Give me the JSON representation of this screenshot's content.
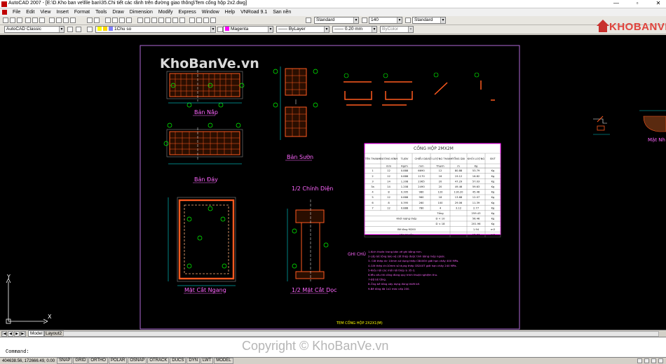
{
  "window": {
    "title": "AutoCAD 2007 - [E:\\D.Kho ban ve\\file ban\\35.Chi tiết các rãnh trên đường giao thông\\Tem cống hộp 2x2.dwg]",
    "min_label": "—",
    "max_label": "▫",
    "close_label": "✕"
  },
  "menu": [
    "File",
    "Edit",
    "View",
    "Insert",
    "Format",
    "Tools",
    "Draw",
    "Dimension",
    "Modify",
    "Express",
    "Window",
    "Help",
    "VNRoad 9.1",
    "San nền"
  ],
  "toolbar1": {
    "text_style": "Standard",
    "dim_scale": "140",
    "dim_style": "Standard"
  },
  "toolbar2": {
    "workspace": "AutoCAD Classic",
    "layer": "1Chu so",
    "color": "Magenta",
    "linetype": "ByLayer",
    "lineweight": "0.20 mm",
    "plotstyle": "ByColor",
    "magenta_hex": "#ff00ff"
  },
  "logo": {
    "text": "KHOBANVE"
  },
  "drawing": {
    "watermark": "KhoBanVe.vn",
    "views": {
      "ban_nap": "Bản Nắp",
      "ban_day": "Bản Đáy",
      "ban_suon": "Bản Sườn",
      "mat_cat_ngang": "Mặt Cắt Ngang",
      "chinh_dien": "1/2 Chính Diện",
      "mat_cat_doc": "1/2 Mặt Cắt Dọc",
      "ghi_chu": "GHI CHÚ",
      "mat_nh": "Mặt Nh"
    },
    "table": {
      "title": "CỐNG HỘP 2MX2M",
      "headers": [
        "TÊN THANH",
        "ĐƯỜNG KÍNH",
        "TL/ĐV",
        "CHIỀU DÀI",
        "SỐ LƯỢNG THANH",
        "TỔNG DÀI",
        "KHỐI LƯỢNG",
        "ĐVT"
      ],
      "units": [
        "",
        "mm",
        "Kg/m",
        "mm",
        "Thanh",
        "m",
        "Kg",
        ""
      ],
      "rows": [
        [
          "1",
          "12",
          "0.888",
          "6690",
          "12",
          "80.88",
          "53.79",
          "Kg"
        ],
        [
          "2",
          "12",
          "0.888",
          "1170",
          "16",
          "19.12",
          "16.82",
          "Kg"
        ],
        [
          "3",
          "14",
          "1.208",
          "2365",
          "20",
          "47.29",
          "57.03",
          "Kg"
        ],
        [
          "3a",
          "14",
          "1.208",
          "2490",
          "20",
          "49.46",
          "59.63",
          "Kg"
        ],
        [
          "4",
          "8",
          "0.395",
          "980",
          "120",
          "116.20",
          "45.46",
          "Kg"
        ],
        [
          "5",
          "12",
          "0.888",
          "960",
          "18",
          "13.68",
          "12.07",
          "Kg"
        ],
        [
          "6",
          "8",
          "0.395",
          "260",
          "100",
          "29.06",
          "11.39",
          "Kg"
        ],
        [
          "7",
          "12",
          "0.888",
          "780",
          "4",
          "3.12",
          "2.77",
          "Kg"
        ]
      ],
      "total_label": "Tổng",
      "total_value": "259.43",
      "steel_label": "Khối lượng thép",
      "d10_label": "D < 10",
      "d10_value": "56.46",
      "d18_label": "D < 18",
      "d18_value": "201.96",
      "concrete_label": "Bê tông M200",
      "concrete_value": "1.94",
      "concrete_unit": "m3",
      "formwork_label": "Ván khuôn",
      "formwork_value": "15.37",
      "formwork_unit": "m2"
    },
    "notes": [
      "1-Kích thước trong bản vẽ ghi bằng mm.",
      "2-Lớp bê tông bảo vệ cốt thép được tính bằng mép ngoài.",
      "3-    Cốt thép d> 10mm sử dụng thép CB400V giới hạn chảy 400 MPa.",
      "4-Cốt thép d<10mm sử dụng thép CB240T giới hạn chảy 240 MPa.",
      "5-Kiểu nối các mối nối thép ≥ 35 d.",
      "6-Yêu cầu thi công đúng quy trình thuật nghiệm thu.",
      "7-Độ bê tông.",
      "8-Ống bê tông xây dựng đúng thiết kế.",
      "9-Bê tông đá 1x2 mác cấp 200."
    ],
    "footer_title": "TEM CỐNG HỘP 2X2X1(M)",
    "axis_y": "Y",
    "axis_x": "X"
  },
  "tabs": {
    "model": "Model",
    "layout": "Layout2"
  },
  "command": {
    "prompt": "Command:",
    "value": ""
  },
  "status": {
    "coords": "404638.56, 172666.49, 0.00",
    "buttons": [
      "SNAP",
      "GRID",
      "ORTHO",
      "POLAR",
      "OSNAP",
      "OTRACK",
      "DUCS",
      "DYN",
      "LWT",
      "MODEL"
    ]
  },
  "copyright": "Copyright © KhoBanVe.vn"
}
